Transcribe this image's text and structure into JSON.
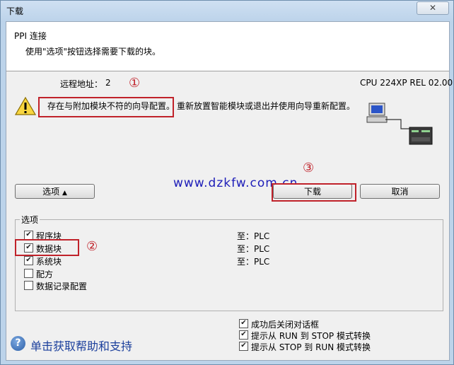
{
  "window": {
    "title": "下载",
    "close_glyph": "✕"
  },
  "header": {
    "title": "PPI 连接",
    "description": "使用\"选项\"按钮选择需要下载的块。"
  },
  "info": {
    "remote_label": "远程地址：",
    "remote_value": "2",
    "cpu": "CPU 224XP REL 02.00"
  },
  "warning": {
    "text_highlighted": "存在与附加模块不符的向导配置。",
    "text_rest": "重新放置智能模块或退出并使用向导重新配置。"
  },
  "annotations": {
    "n1": "①",
    "n2": "②",
    "n3": "③",
    "watermark": "www.dzkfw.com.cn"
  },
  "buttons": {
    "options": "选项",
    "options_glyph": "▲",
    "download": "下载",
    "cancel": "取消"
  },
  "options": {
    "group_title": "选项",
    "items": [
      {
        "label": "程序块",
        "checked": "✔",
        "target": "至：PLC"
      },
      {
        "label": "数据块",
        "checked": "✔",
        "target": "至：PLC"
      },
      {
        "label": "系统块",
        "checked": "✔",
        "target": "至：PLC"
      },
      {
        "label": "配方",
        "checked": ""
      },
      {
        "label": "数据记录配置",
        "checked": ""
      }
    ]
  },
  "bottom_checks": [
    {
      "label": "成功后关闭对话框",
      "checked": "✔"
    },
    {
      "label": "提示从 RUN 到 STOP 模式转换",
      "checked": "✔"
    },
    {
      "label": "提示从 STOP 到 RUN 模式转换",
      "checked": "✔"
    }
  ],
  "help": {
    "icon": "?",
    "text": "单击获取帮助和支持"
  },
  "colors": {
    "annotation_red": "#c0222a",
    "link_blue": "#1b3f9c",
    "watermark_blue": "#1d1db8"
  }
}
